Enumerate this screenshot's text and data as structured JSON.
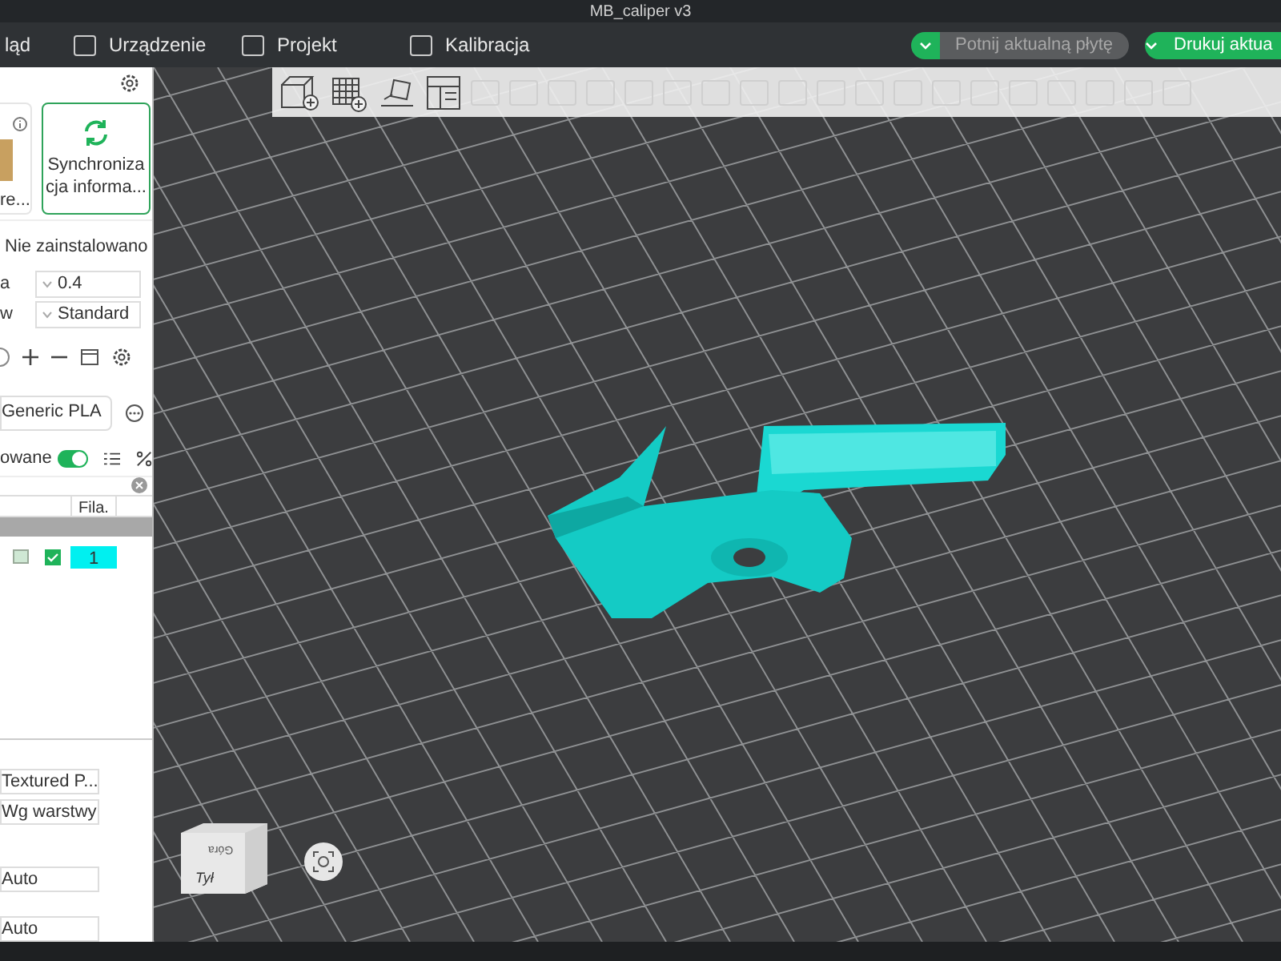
{
  "window": {
    "title": "MB_caliper v3"
  },
  "menu": [
    {
      "label": "ląd"
    },
    {
      "label": "Urządzenie"
    },
    {
      "label": "Projekt"
    },
    {
      "label": "Kalibracja"
    }
  ],
  "actions": [
    {
      "label": "Potnij aktualną płytę",
      "disabled": true
    },
    {
      "label": "Drukuj aktua",
      "disabled": false
    }
  ],
  "printer": {
    "card_label": "re...",
    "sync_label": "Synchroniza cja informa...",
    "status": "Nie zainstalowano",
    "settings": [
      {
        "label": "a",
        "value": "0.4"
      },
      {
        "label": "w",
        "value": "Standard"
      }
    ]
  },
  "filament": {
    "value": "Generic PLA",
    "toggle_label": "owane",
    "toggle_on": true
  },
  "table": {
    "columns": [
      "Fila."
    ],
    "rows": [
      {
        "checked": true,
        "filament": "1"
      }
    ]
  },
  "options": [
    {
      "value": "Textured P..."
    },
    {
      "value": "Wg warstwy"
    },
    {
      "value": "Auto"
    },
    {
      "value": "Auto"
    }
  ],
  "view_cube": {
    "front": "Tył",
    "top": "Góra"
  }
}
